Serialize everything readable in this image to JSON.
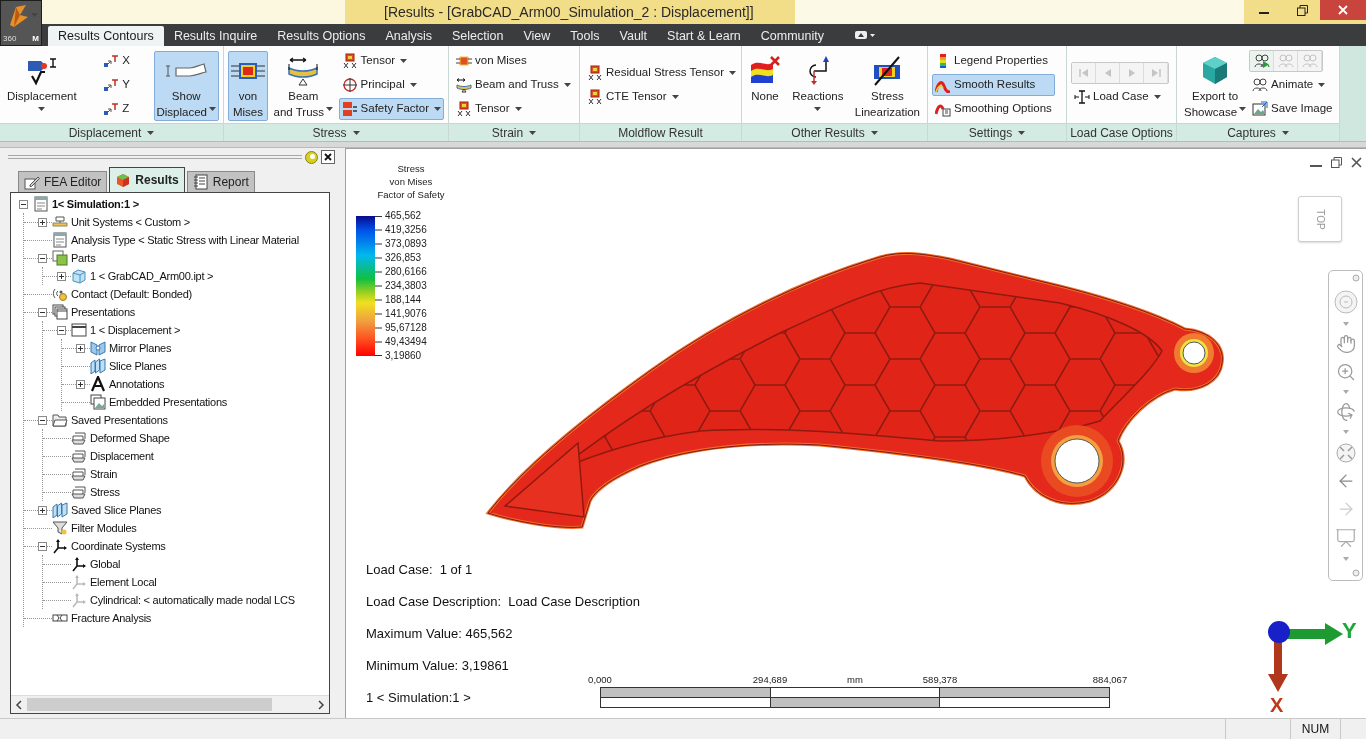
{
  "title_bar": {
    "app_badge": "360",
    "app_letter": "M",
    "title": "[Results - [GrabCAD_Arm00_Simulation_2 : Displacement]]"
  },
  "menu_tabs": [
    {
      "label": "Results Contours",
      "selected": true
    },
    {
      "label": "Results Inquire",
      "selected": false
    },
    {
      "label": "Results Options",
      "selected": false
    },
    {
      "label": "Analysis",
      "selected": false
    },
    {
      "label": "Selection",
      "selected": false
    },
    {
      "label": "View",
      "selected": false
    },
    {
      "label": "Tools",
      "selected": false
    },
    {
      "label": "Vault",
      "selected": false
    },
    {
      "label": "Start & Learn",
      "selected": false
    },
    {
      "label": "Community",
      "selected": false
    }
  ],
  "ribbon": {
    "groups": [
      {
        "title": "Displacement",
        "menu": true,
        "columns": [
          {
            "items": [
              {
                "kind": "large",
                "label": "Displacement",
                "dropdown": true,
                "selected": false
              }
            ]
          },
          {
            "items": [
              {
                "kind": "small",
                "label": "X",
                "dropdown": false,
                "selected": false
              },
              {
                "kind": "small",
                "label": "Y",
                "dropdown": false,
                "selected": false
              },
              {
                "kind": "small",
                "label": "Z",
                "dropdown": false,
                "selected": false
              }
            ]
          },
          {
            "items": [
              {
                "kind": "large",
                "label": "Show\nDisplaced",
                "dropdown": true,
                "selected": true
              }
            ]
          }
        ]
      },
      {
        "title": "Stress",
        "menu": true,
        "columns": [
          {
            "items": [
              {
                "kind": "large",
                "label": "von\nMises",
                "dropdown": false,
                "selected": true
              }
            ]
          },
          {
            "items": [
              {
                "kind": "large",
                "label": "Beam\nand Truss",
                "dropdown": true,
                "selected": false
              }
            ]
          },
          {
            "items": [
              {
                "kind": "small",
                "label": "Tensor",
                "dropdown": true,
                "selected": false
              },
              {
                "kind": "small",
                "label": "Principal",
                "dropdown": true,
                "selected": false
              },
              {
                "kind": "small",
                "label": "Safety Factor",
                "dropdown": true,
                "selected": true
              }
            ]
          }
        ]
      },
      {
        "title": "Strain",
        "menu": true,
        "columns": [
          {
            "items": [
              {
                "kind": "small",
                "label": "von Mises",
                "dropdown": false,
                "selected": false
              },
              {
                "kind": "small",
                "label": "Beam and Truss",
                "dropdown": true,
                "selected": false
              },
              {
                "kind": "small",
                "label": "Tensor",
                "dropdown": true,
                "selected": false
              }
            ]
          }
        ]
      },
      {
        "title": "Moldflow Result",
        "menu": false,
        "columns": [
          {
            "items": [
              {
                "kind": "small",
                "label": "Residual Stress Tensor",
                "dropdown": true,
                "selected": false
              },
              {
                "kind": "small",
                "label": "CTE Tensor",
                "dropdown": true,
                "selected": false
              }
            ]
          }
        ]
      },
      {
        "title": "Other Results",
        "menu": true,
        "columns": [
          {
            "items": [
              {
                "kind": "large",
                "label": "None",
                "dropdown": false,
                "selected": false
              }
            ]
          },
          {
            "items": [
              {
                "kind": "large",
                "label": "Reactions",
                "dropdown": true,
                "selected": false
              }
            ]
          },
          {
            "items": [
              {
                "kind": "large",
                "label": "Stress\nLinearization",
                "dropdown": false,
                "selected": false
              }
            ]
          }
        ]
      },
      {
        "title": "Settings",
        "menu": true,
        "columns": [
          {
            "items": [
              {
                "kind": "small",
                "label": "Legend Properties",
                "dropdown": false,
                "selected": false
              },
              {
                "kind": "small",
                "label": "Smooth Results",
                "dropdown": false,
                "selected": true
              },
              {
                "kind": "small",
                "label": "Smoothing Options",
                "dropdown": false,
                "selected": false
              }
            ]
          }
        ]
      },
      {
        "title": "Load Case Options",
        "menu": false,
        "columns": [
          {
            "items": [
              {
                "kind": "icons",
                "buttons": [
                  {
                    "disabled": true
                  },
                  {
                    "disabled": true
                  },
                  {
                    "disabled": true
                  },
                  {
                    "disabled": true
                  }
                ]
              },
              {
                "kind": "small",
                "label": "Load Case",
                "dropdown": true,
                "selected": false
              }
            ]
          }
        ]
      },
      {
        "title": "Captures",
        "menu": true,
        "columns": [
          {
            "items": [
              {
                "kind": "large",
                "label": "Export to\nShowcase",
                "dropdown": true,
                "selected": false
              }
            ]
          },
          {
            "items": [
              {
                "kind": "icons",
                "buttons": [
                  {
                    "disabled": false
                  },
                  {
                    "disabled": true
                  },
                  {
                    "disabled": true
                  }
                ]
              },
              {
                "kind": "small",
                "label": "Animate",
                "dropdown": true,
                "selected": false
              },
              {
                "kind": "small",
                "label": "Save Image",
                "dropdown": false,
                "selected": false
              }
            ]
          }
        ]
      }
    ]
  },
  "browser": {
    "tabs": [
      {
        "label": "FEA Editor",
        "selected": false
      },
      {
        "label": "Results",
        "selected": true
      },
      {
        "label": "Report",
        "selected": false
      }
    ],
    "tree": [
      {
        "kind": "simulation",
        "label": "1< Simulation:1 >",
        "expanded": true,
        "children": [
          {
            "kind": "units",
            "label": "Unit Systems < Custom >",
            "expanded": false
          },
          {
            "kind": "document",
            "label": "Analysis Type < Static Stress with Linear Material"
          },
          {
            "kind": "parts",
            "label": "Parts",
            "expanded": true,
            "children": [
              {
                "kind": "part",
                "label": "1 < GrabCAD_Arm00.ipt >",
                "expanded": false
              }
            ]
          },
          {
            "kind": "contact",
            "label": "Contact (Default: Bonded)"
          },
          {
            "kind": "presentations",
            "label": "Presentations",
            "expanded": true,
            "children": [
              {
                "kind": "window",
                "label": "1 < Displacement >",
                "expanded": true,
                "children": [
                  {
                    "kind": "mirror",
                    "label": "Mirror Planes",
                    "expanded": false
                  },
                  {
                    "kind": "planes",
                    "label": "Slice Planes"
                  },
                  {
                    "kind": "annotation",
                    "label": "Annotations",
                    "expanded": false
                  },
                  {
                    "kind": "embedded",
                    "label": "Embedded Presentations"
                  }
                ]
              }
            ]
          },
          {
            "kind": "folder",
            "label": "Saved Presentations",
            "expanded": true,
            "children": [
              {
                "kind": "view",
                "label": "Deformed Shape"
              },
              {
                "kind": "view",
                "label": "Displacement"
              },
              {
                "kind": "view",
                "label": "Strain"
              },
              {
                "kind": "view",
                "label": "Stress"
              }
            ]
          },
          {
            "kind": "planes",
            "label": "Saved Slice Planes",
            "expanded": false
          },
          {
            "kind": "filter",
            "label": "Filter Modules"
          },
          {
            "kind": "axes",
            "label": "Coordinate Systems",
            "expanded": true,
            "children": [
              {
                "kind": "axes",
                "label": "Global"
              },
              {
                "kind": "local",
                "label": "Element Local"
              },
              {
                "kind": "local",
                "label": "Cylindrical: < automatically made nodal LCS"
              }
            ]
          },
          {
            "kind": "fracture",
            "label": "Fracture Analysis"
          }
        ]
      }
    ]
  },
  "viewport": {
    "legend": {
      "title": [
        "Stress",
        "von Mises",
        "Factor of Safety"
      ],
      "values": [
        "465,562",
        "419,3256",
        "373,0893",
        "326,853",
        "280,6166",
        "234,3803",
        "188,144",
        "141,9076",
        "95,67128",
        "49,43494",
        "3,19860"
      ]
    },
    "view_cube": "TOP",
    "info": [
      "Load Case:  1 of 1",
      "Load Case Description:  Load Case Description",
      "Maximum Value: 465,562",
      "Minimum Value: 3,19861",
      "1 < Simulation:1 >"
    ],
    "scale_bar": {
      "ticks": [
        "0,000",
        "294,689",
        "589,378",
        "884,067"
      ],
      "unit": "mm"
    },
    "triad": {
      "y": "Y",
      "x": "X"
    }
  },
  "status_bar": {
    "indicators": [
      "NUM"
    ]
  }
}
